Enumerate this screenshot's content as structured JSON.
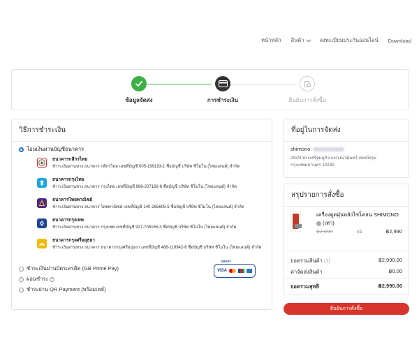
{
  "nav": {
    "home": "หน้าหลัก",
    "products": "สินค้า",
    "register": "ลงทะเบียนประกันออนไลน์",
    "download": "Download"
  },
  "steps": [
    {
      "label": "ข้อมูลจัดส่ง",
      "state": "done"
    },
    {
      "label": "การชำระเงิน",
      "state": "active"
    },
    {
      "label": "ยืนยันการสั่งซื้อ",
      "state": "pending"
    }
  ],
  "payment": {
    "title": "วิธีการชำระเงิน",
    "bank_transfer_label": "โอนเงินผ่านบัญชีธนาคาร",
    "banks": [
      {
        "name": "ธนาคารกสิกรไทย",
        "detail": "ชำระเงินผ่านทาง ธนาคาร กสิกรไทย เลขที่บัญชี 005-199193-1 ชื่อบัญชี บริษัท ชิโมโน (ไทยแลนด์) จำกัด",
        "color": "#138f2d"
      },
      {
        "name": "ธนาคารกรุงไทย",
        "detail": "ชำระเงินผ่านทาง ธนาคาร กรุงไทย เลขที่บัญชี 986-207182-6 ชื่อบัญชี บริษัท ชิโมโน (ไทยแลนด์) จำกัด",
        "color": "#1ba5e1"
      },
      {
        "name": "ธนาคารไทยพาณิชย์",
        "detail": "ชำระเงินผ่านทาง ธนาคาร ไทยพาณิชย์ เลขที่บัญชี 140-265605-5 ชื่อบัญชี บริษัท ชิโมโน (ไทยแลนด์) จำกัด",
        "color": "#4e2a84"
      },
      {
        "name": "ธนาคารกรุงเทพ",
        "detail": "ชำระเงินผ่านทาง ธนาคาร กรุงเทพ เลขที่บัญชี 927-705165-3 ชื่อบัญชี บริษัท ชิโมโน (ไทยแลนด์) จำกัด",
        "color": "#1e4598"
      },
      {
        "name": "ธนาคารกรุงศรีอยุธยา",
        "detail": "ชำระเงินผ่านทาง ธนาคาร ธนาคารกรุงศรีอยุธยา เลขที่บัญชี 486-119942-6 ชื่อบัญชี บริษัท ชิโมโน (ไทยแลนด์) จำกัด",
        "color": "#f5b800"
      }
    ],
    "credit_card_label": "ชำระเงินผ่านบัตรเครดิต (GB Prime Pay)",
    "installment_label": "ผ่อนชำระ",
    "qr_label": "ชำระผ่าน QR Payment (พร้อมเพย์)",
    "card_brands": [
      "VISA",
      "MasterCard",
      "JCB",
      "AMEX"
    ],
    "gbpay_text": "GBPAY"
  },
  "address": {
    "title": "ที่อยู่ในการจัดส่ง",
    "name": "shimono",
    "line1": "292/3 ประเสริฐมนูกิจ แขวงนวมินทร์ เขตบึงกุ่ม",
    "line2": "กรุงเทพมหานคร 10230"
  },
  "summary": {
    "title": "สรุปรายการสั่งซื้อ",
    "product_name": "เครื่องดูดฝุ่นพลังไซโคลน SHIMONO",
    "product_variant": "(เทา)",
    "product_old_price": "฿2,990",
    "product_qty": "x1",
    "product_price": "฿2,990",
    "subtotal_label": "ยอดรวมสินค้า",
    "subtotal_count": "(1)",
    "subtotal_value": "฿2,990.00",
    "shipping_label": "ค่าจัดส่งสินค้า",
    "shipping_value": "฿0.00",
    "total_label": "ยอดรวมสุทธิ",
    "total_value": "฿2,990.00"
  },
  "confirm_button": "ยืนยันการสั่งซื้อ",
  "colors": {
    "accent_green": "#3cb043",
    "confirm_red": "#d9342b",
    "radio_blue": "#1a73e8"
  }
}
